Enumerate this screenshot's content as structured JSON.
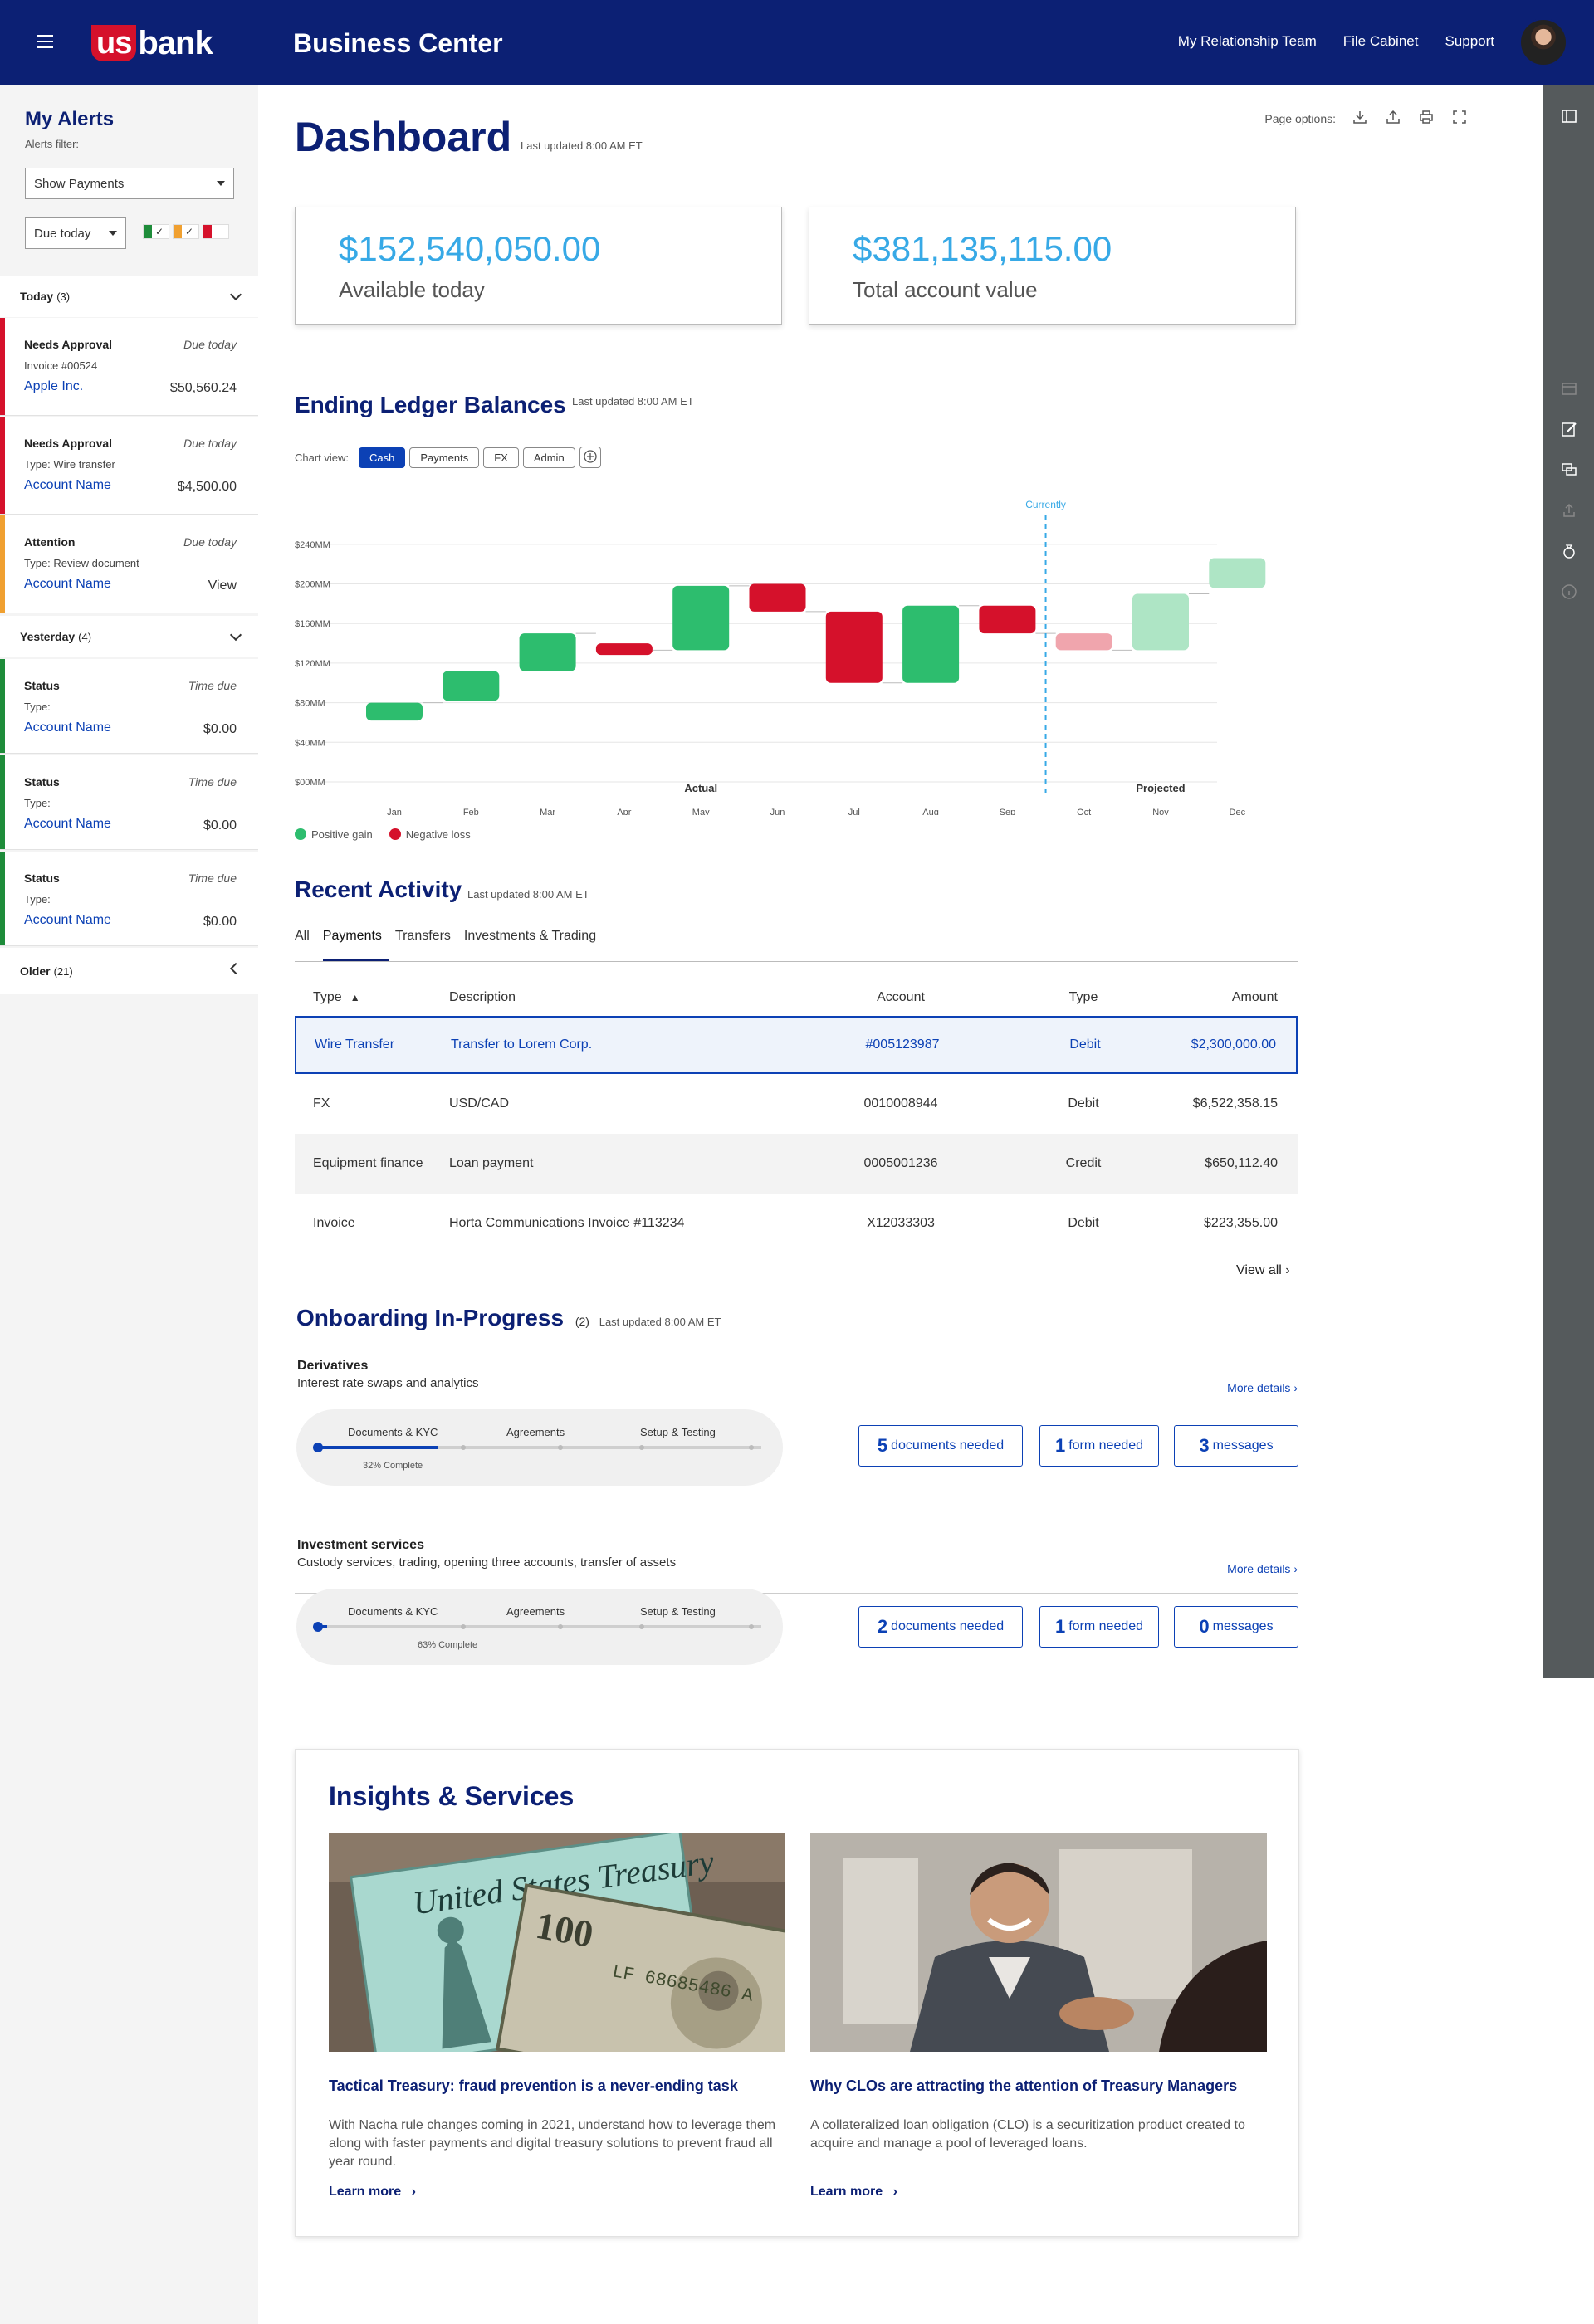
{
  "header": {
    "logo_us": "us",
    "logo_bank": "bank",
    "app_title": "Business Center",
    "nav": [
      "My Relationship Team",
      "File Cabinet",
      "Support"
    ]
  },
  "alerts": {
    "title": "My Alerts",
    "filter_label": "Alerts filter:",
    "filter_value": "Show Payments",
    "due_value": "Due today",
    "groups": {
      "today": {
        "label": "Today",
        "count": "(3)"
      },
      "yesterday": {
        "label": "Yesterday",
        "count": "(4)"
      },
      "older": {
        "label": "Older",
        "count": "(21)"
      }
    },
    "cards": [
      {
        "title": "Needs Approval",
        "due": "Due today",
        "sub": "Invoice #00524",
        "name": "Apple Inc.",
        "amount": "$50,560.24",
        "color": "#d5112b"
      },
      {
        "title": "Needs Approval",
        "due": "Due today",
        "sub": "Type: Wire transfer",
        "name": "Account Name",
        "amount": "$4,500.00",
        "color": "#d5112b"
      },
      {
        "title": "Attention",
        "due": "Due today",
        "sub": "Type: Review document",
        "name": "Account Name",
        "amount": "View",
        "color": "#f0a030"
      },
      {
        "title": "Status",
        "due": "Time due",
        "sub": "Type:",
        "name": "Account Name",
        "amount": "$0.00",
        "color": "#1e8c3a"
      },
      {
        "title": "Status",
        "due": "Time due",
        "sub": "Type:",
        "name": "Account Name",
        "amount": "$0.00",
        "color": "#1e8c3a"
      },
      {
        "title": "Status",
        "due": "Time due",
        "sub": "Type:",
        "name": "Account Name",
        "amount": "$0.00",
        "color": "#1e8c3a"
      }
    ]
  },
  "dashboard": {
    "title": "Dashboard",
    "updated": "Last updated 8:00 AM ET",
    "page_options": "Page options:",
    "kpis": [
      {
        "value": "$152,540,050.00",
        "label": "Available today"
      },
      {
        "value": "$381,135,115.00",
        "label": "Total account value"
      }
    ]
  },
  "ledger": {
    "title": "Ending Ledger Balances",
    "updated": "Last updated 8:00 AM ET",
    "chart_view_label": "Chart view:",
    "views": [
      "Cash",
      "Payments",
      "FX",
      "Admin"
    ],
    "legend": {
      "positive": "Positive gain",
      "negative": "Negative loss"
    }
  },
  "chart_data": {
    "type": "bar",
    "subtype": "waterfall",
    "categories": [
      "Jan",
      "Feb",
      "Mar",
      "Apr",
      "May",
      "Jun",
      "Jul",
      "Aug",
      "Sep",
      "Oct",
      "Nov",
      "Dec"
    ],
    "open": [
      62,
      82,
      112,
      140,
      133,
      200,
      172,
      100,
      178,
      150,
      133,
      196
    ],
    "close": [
      80,
      112,
      150,
      133,
      198,
      172,
      100,
      178,
      150,
      133,
      190,
      226
    ],
    "projected_from_index": 9,
    "current_marker_label": "Currently",
    "region_labels": {
      "actual": "Actual",
      "projected": "Projected"
    },
    "y_ticks": [
      "$00MM",
      "$40MM",
      "$80MM",
      "$120MM",
      "$160MM",
      "$200MM",
      "$240MM"
    ],
    "ylim": [
      0,
      260
    ],
    "colors": {
      "positive": "#2dbd6e",
      "negative": "#d5112b",
      "positive_projected": "#aee5c5",
      "negative_projected": "#f0a5ad"
    }
  },
  "activity": {
    "title": "Recent Activity",
    "updated": "Last updated 8:00 AM ET",
    "tabs": [
      "All",
      "Payments",
      "Transfers",
      "Investments & Trading"
    ],
    "columns": [
      "Type",
      "Description",
      "Account",
      "Type",
      "Amount"
    ],
    "rows": [
      [
        "Wire Transfer",
        "Transfer to Lorem Corp.",
        "#005123987",
        "Debit",
        "$2,300,000.00"
      ],
      [
        "FX",
        "USD/CAD",
        "0010008944",
        "Debit",
        "$6,522,358.15"
      ],
      [
        "Equipment finance",
        "Loan payment",
        "0005001236",
        "Credit",
        "$650,112.40"
      ],
      [
        "Invoice",
        "Horta Communications Invoice #113234",
        "X12033303",
        "Debit",
        "$223,355.00"
      ]
    ],
    "view_all": "View all"
  },
  "onboarding": {
    "title": "Onboarding In-Progress",
    "count": "(2)",
    "updated": "Last updated 8:00 AM ET",
    "steps": [
      "Documents & KYC",
      "Agreements",
      "Setup & Testing"
    ],
    "more": "More details",
    "items": [
      {
        "title": "Derivatives",
        "sub": "Interest rate swaps and analytics",
        "pct": "32% Complete",
        "progress": 0.27,
        "docs_n": "5",
        "docs_l": "documents needed",
        "form_n": "1",
        "form_l": "form needed",
        "msg_n": "3",
        "msg_l": "messages"
      },
      {
        "title": "Investment services",
        "sub": "Custody services, trading, opening three accounts, transfer of assets",
        "pct": "63% Complete",
        "progress": 0.02,
        "docs_n": "2",
        "docs_l": "documents needed",
        "form_n": "1",
        "form_l": "form needed",
        "msg_n": "0",
        "msg_l": "messages"
      }
    ]
  },
  "insights": {
    "title": "Insights & Services",
    "articles": [
      {
        "title": "Tactical Treasury: fraud prevention is a never-ending task",
        "body": "With Nacha rule changes coming in 2021, understand how to leverage them along with faster payments and digital treasury solutions to prevent fraud all year round.",
        "link": "Learn more"
      },
      {
        "title": "Why CLOs are attracting the attention of Treasury Managers",
        "body": "A collateralized loan obligation (CLO) is a securitization product created to acquire and manage a pool of leveraged loans.",
        "link": "Learn more"
      }
    ]
  }
}
